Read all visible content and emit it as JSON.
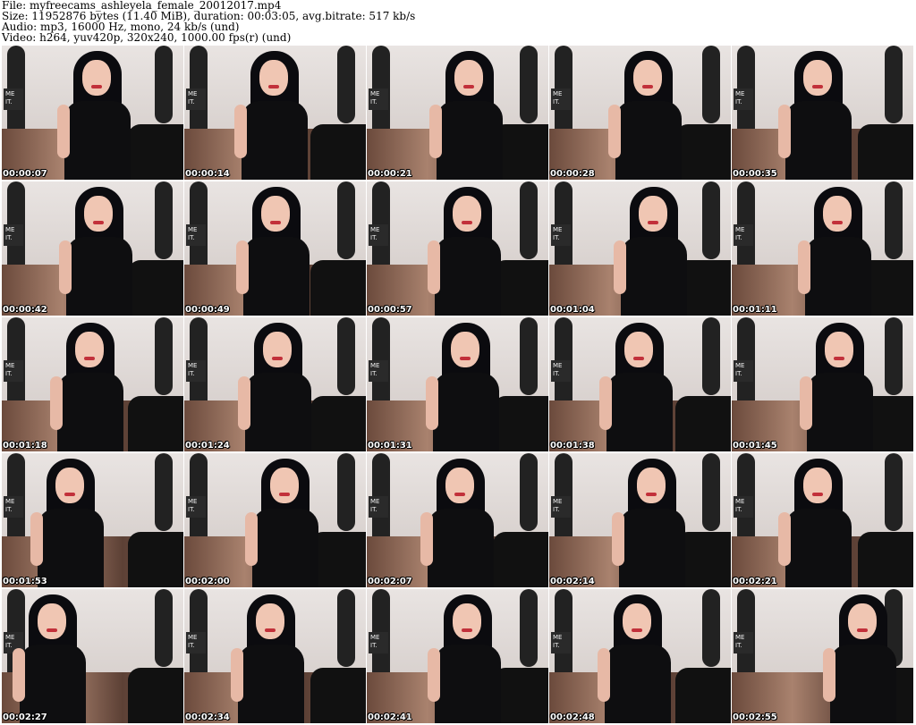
{
  "header": {
    "file_line": "File: myfreecams_ashleyela_female_20012017.mp4",
    "size_line": "Size: 11952876 bytes (11.40 MiB), duration: 00:03:05, avg.bitrate: 517 kb/s",
    "audio_line": "Audio: mp3, 16000 Hz, mono, 24 kb/s (und)",
    "video_line": "Video: h264, yuv420p, 320x240, 1000.00 fps(r) (und)"
  },
  "sign_text": "ME\nIT.",
  "thumbnails": [
    {
      "time": "00:00:07"
    },
    {
      "time": "00:00:14"
    },
    {
      "time": "00:00:21"
    },
    {
      "time": "00:00:28"
    },
    {
      "time": "00:00:35"
    },
    {
      "time": "00:00:42"
    },
    {
      "time": "00:00:49"
    },
    {
      "time": "00:00:57"
    },
    {
      "time": "00:01:04"
    },
    {
      "time": "00:01:11"
    },
    {
      "time": "00:01:18"
    },
    {
      "time": "00:01:24"
    },
    {
      "time": "00:01:31"
    },
    {
      "time": "00:01:38"
    },
    {
      "time": "00:01:45"
    },
    {
      "time": "00:01:53"
    },
    {
      "time": "00:02:00"
    },
    {
      "time": "00:02:07"
    },
    {
      "time": "00:02:14"
    },
    {
      "time": "00:02:21"
    },
    {
      "time": "00:02:27"
    },
    {
      "time": "00:02:34"
    },
    {
      "time": "00:02:41"
    },
    {
      "time": "00:02:48"
    },
    {
      "time": "00:02:55"
    }
  ]
}
